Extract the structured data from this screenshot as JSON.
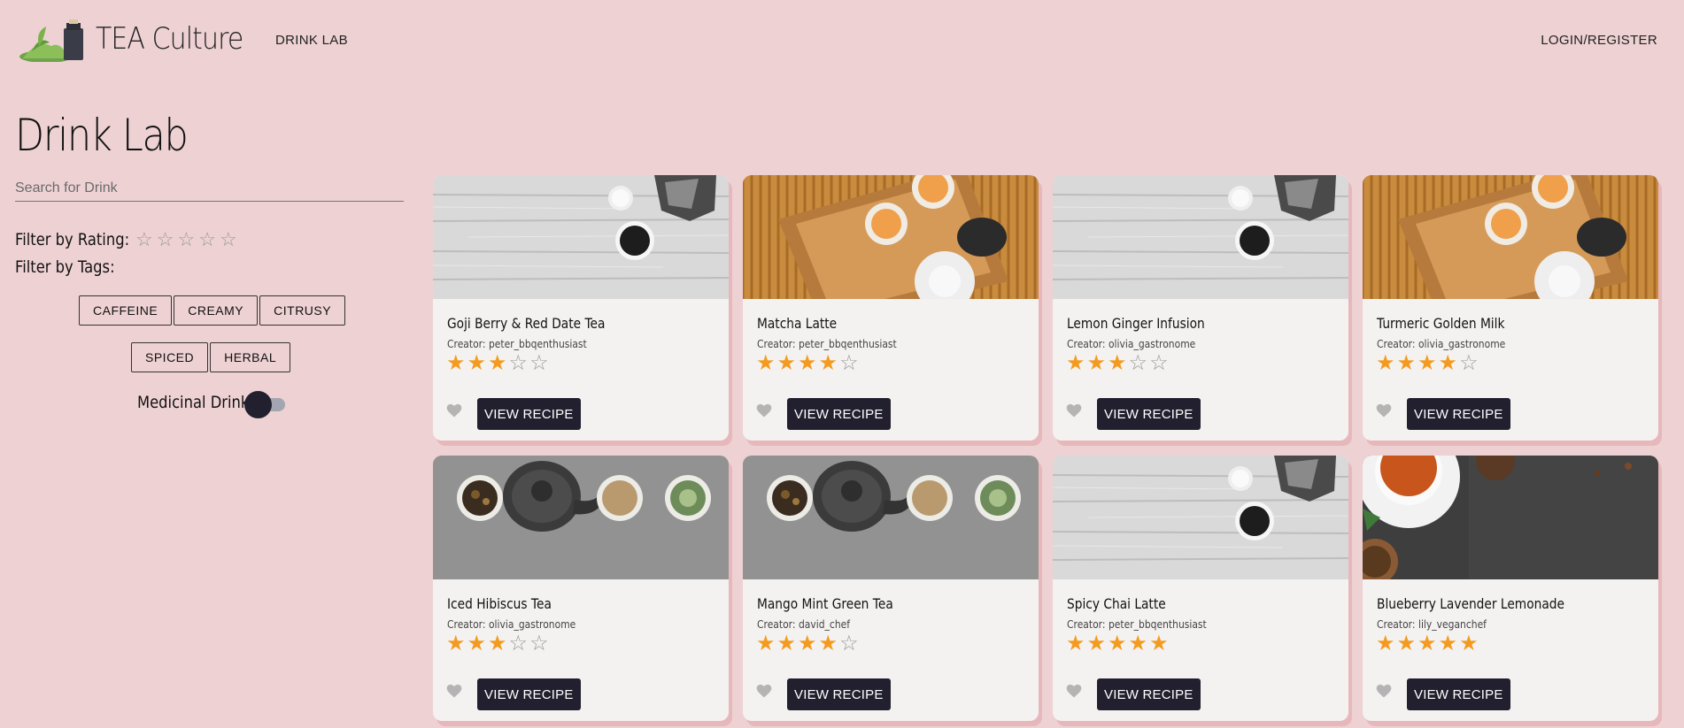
{
  "nav": {
    "brand": "TEA Culture",
    "drink_lab_link": "DRINK LAB",
    "login_link": "LOGIN/REGISTER"
  },
  "sidebar": {
    "title": "Drink Lab",
    "search_placeholder": "Search for Drink",
    "filter_rating_label": "Filter by Rating:",
    "filter_rating_value": 0,
    "filter_tags_label": "Filter by Tags:",
    "tags": [
      "CAFFEINE",
      "CREAMY",
      "CITRUSY",
      "SPICED",
      "HERBAL"
    ],
    "medicinal_label": "Medicinal Drink",
    "medicinal_on": false
  },
  "cards": [
    {
      "title": "Goji Berry & Red Date Tea",
      "creator": "Creator: peter_bbqenthusiast",
      "rating": 3,
      "image": "wood-kettle",
      "button": "VIEW RECIPE"
    },
    {
      "title": "Matcha Latte",
      "creator": "Creator: peter_bbqenthusiast",
      "rating": 4,
      "image": "bamboo-tray",
      "button": "VIEW RECIPE"
    },
    {
      "title": "Lemon Ginger Infusion",
      "creator": "Creator: olivia_gastronome",
      "rating": 3,
      "image": "wood-kettle",
      "button": "VIEW RECIPE"
    },
    {
      "title": "Turmeric Golden Milk",
      "creator": "Creator: olivia_gastronome",
      "rating": 4,
      "image": "bamboo-tray",
      "button": "VIEW RECIPE"
    },
    {
      "title": "Iced Hibiscus Tea",
      "creator": "Creator: olivia_gastronome",
      "rating": 3,
      "image": "teapot-cups",
      "button": "VIEW RECIPE"
    },
    {
      "title": "Mango Mint Green Tea",
      "creator": "Creator: david_chef",
      "rating": 4,
      "image": "teapot-cups",
      "button": "VIEW RECIPE"
    },
    {
      "title": "Spicy Chai Latte",
      "creator": "Creator: peter_bbqenthusiast",
      "rating": 5,
      "image": "wood-kettle",
      "button": "VIEW RECIPE"
    },
    {
      "title": "Blueberry Lavender Lemonade",
      "creator": "Creator: lily_veganchef",
      "rating": 5,
      "image": "dark-stone",
      "button": "VIEW RECIPE"
    }
  ],
  "colors": {
    "background": "#eed1d3",
    "button": "#22202f",
    "star_active": "#f49b1f",
    "card": "#f4f2f1"
  },
  "icons": {
    "logo": "tea-hills-logo-icon",
    "heart": "heart-icon",
    "star": "star-icon"
  }
}
